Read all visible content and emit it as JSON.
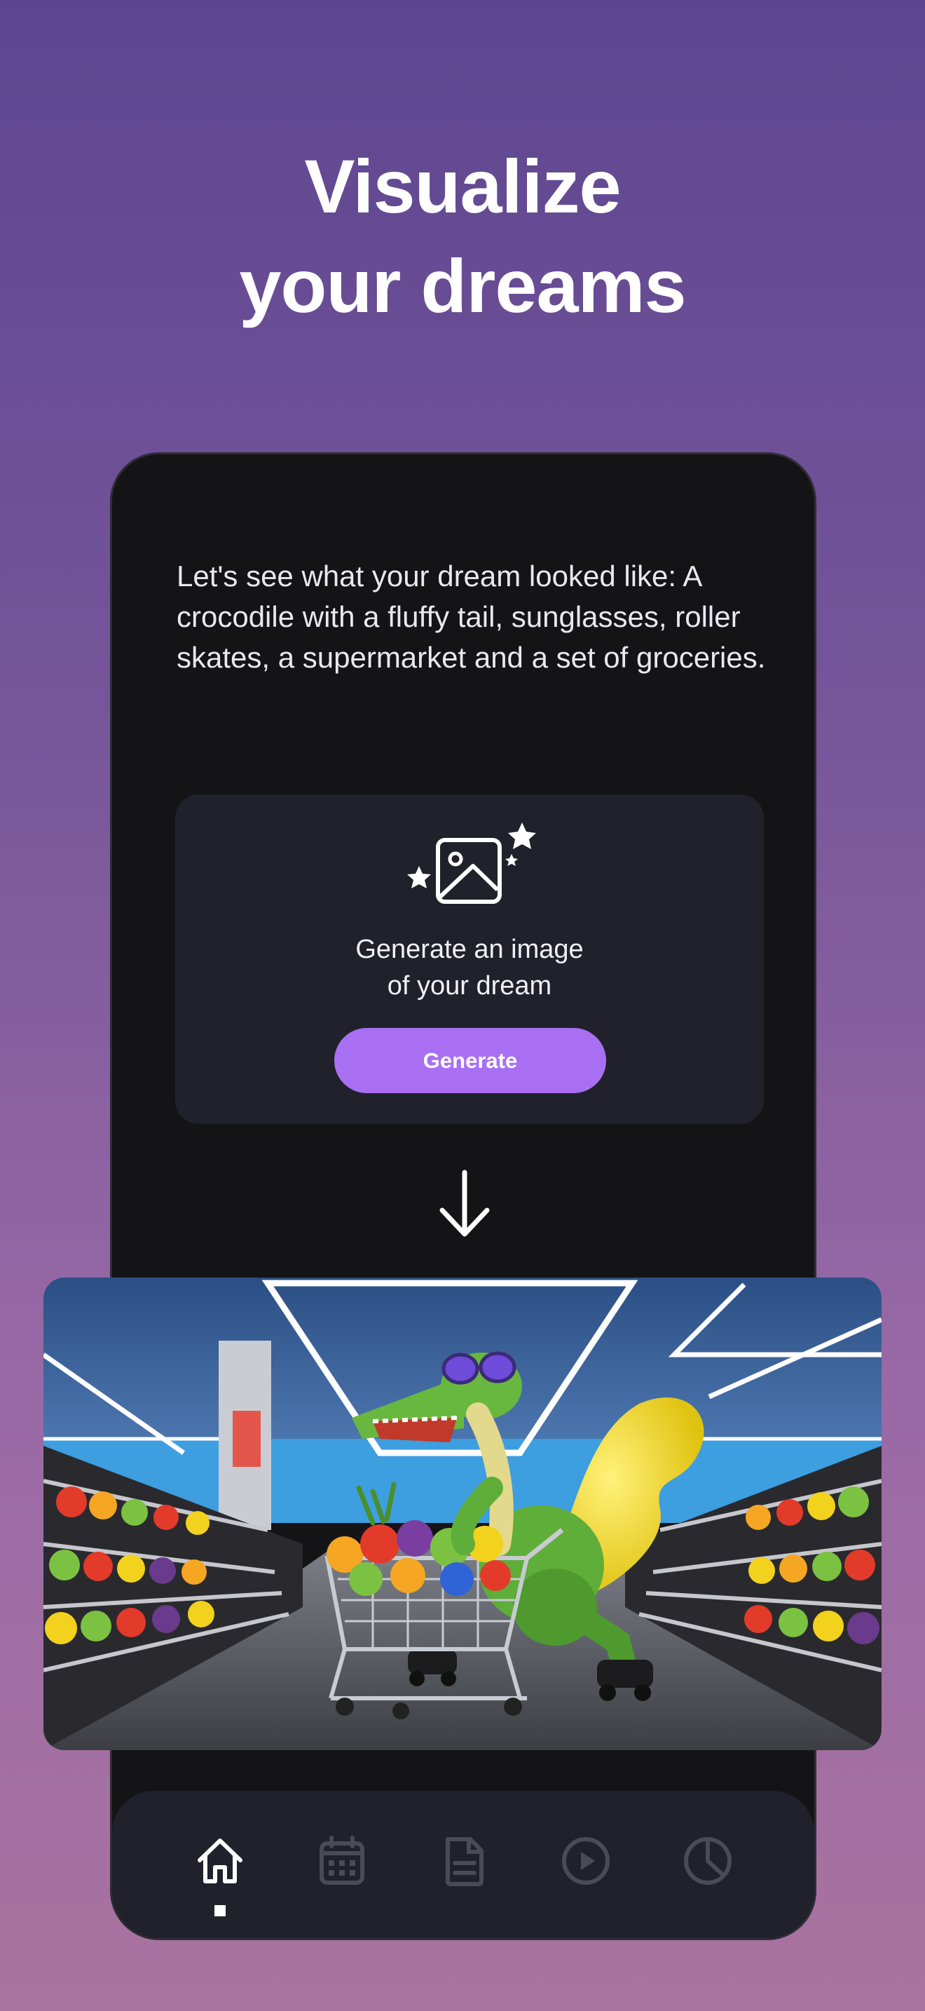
{
  "headline": {
    "line1": "Visualize",
    "line2": "your dreams"
  },
  "prompt": {
    "text": "Let's see what your dream looked like: A crocodile with a fluffy tail, sunglasses, roller skates, a supermarket and a set of groceries."
  },
  "generate_card": {
    "icon": "image-sparkle-icon",
    "caption_line1": "Generate an image",
    "caption_line2": "of your dream",
    "button_label": "Generate"
  },
  "arrow_icon": "arrow-down-icon",
  "result_image": {
    "description_icon": "generated-image"
  },
  "bottom_nav": {
    "items": [
      {
        "icon": "home-icon",
        "active": true
      },
      {
        "icon": "calendar-icon",
        "active": false
      },
      {
        "icon": "document-icon",
        "active": false
      },
      {
        "icon": "play-icon",
        "active": false
      },
      {
        "icon": "pie-chart-icon",
        "active": false
      }
    ]
  },
  "colors": {
    "accent": "#a86ff2",
    "phone_bg": "#141417",
    "card_bg": "#20212b",
    "bg_top": "#5d4690",
    "bg_bottom": "#a9739f"
  }
}
